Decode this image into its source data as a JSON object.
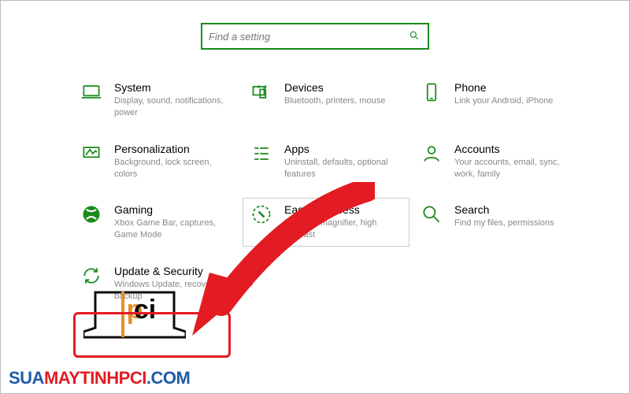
{
  "search": {
    "placeholder": "Find a setting"
  },
  "tiles": {
    "system": {
      "title": "System",
      "sub": "Display, sound, notifications, power"
    },
    "devices": {
      "title": "Devices",
      "sub": "Bluetooth, printers, mouse"
    },
    "phone": {
      "title": "Phone",
      "sub": "Link your Android, iPhone"
    },
    "personal": {
      "title": "Personalization",
      "sub": "Background, lock screen, colors"
    },
    "apps": {
      "title": "Apps",
      "sub": "Uninstall, defaults, optional features"
    },
    "accounts": {
      "title": "Accounts",
      "sub": "Your accounts, email, sync, work, family"
    },
    "gaming": {
      "title": "Gaming",
      "sub": "Xbox Game Bar, captures, Game Mode"
    },
    "ease": {
      "title": "Ease of Access",
      "sub": "Narrator, magnifier, high contrast"
    },
    "search": {
      "title": "Search",
      "sub": "Find my files, permissions"
    },
    "update": {
      "title": "Update & Security",
      "sub": "Windows Update, recovery, backup"
    }
  },
  "watermark": {
    "logo_text": "pci",
    "site": "SUAMAYTINHPCI.COM"
  },
  "colors": {
    "accent": "#1a8a1a",
    "highlight": "#e31b23",
    "blue": "#1f5aa8"
  }
}
